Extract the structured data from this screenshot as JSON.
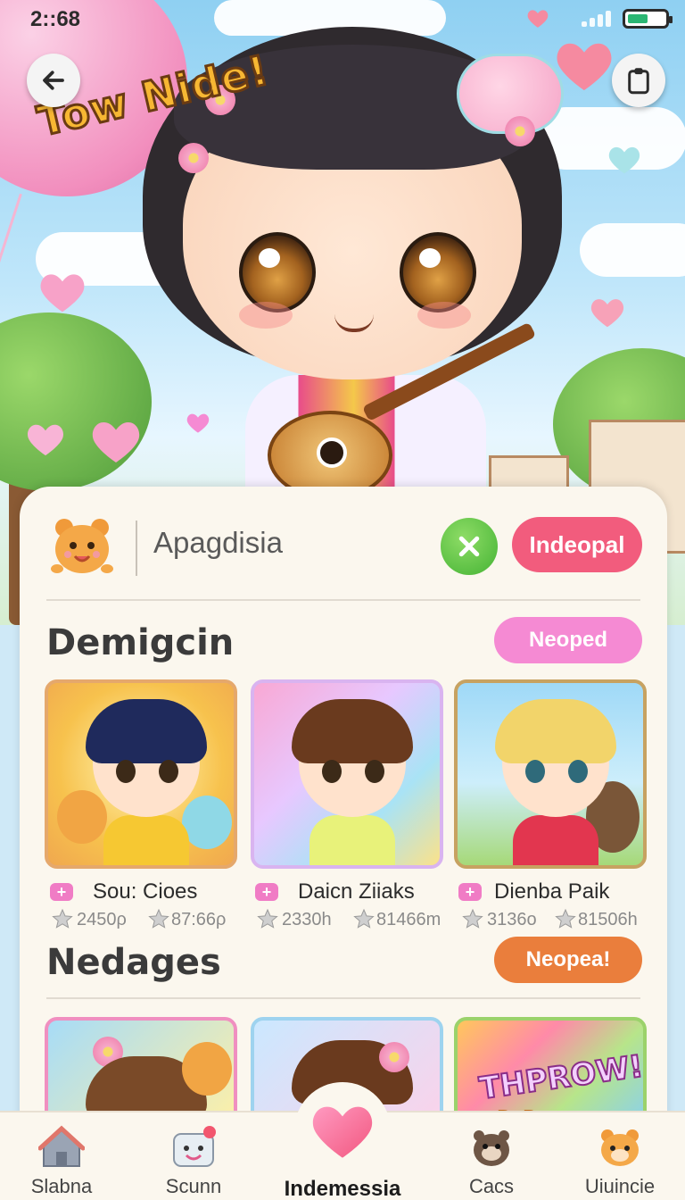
{
  "status_bar": {
    "time": "2::68"
  },
  "hero": {
    "title_art": "Tow Nide!"
  },
  "header_actions": {
    "back_icon": "back-arrow-icon",
    "share_icon": "clipboard-icon"
  },
  "search": {
    "text": "Apagdisia",
    "clear_icon": "close-icon",
    "action_label": "Indeopal"
  },
  "sections": [
    {
      "title": "Demigcin",
      "action_label": "Neoped",
      "cards": [
        {
          "name": "Sou: Cioes",
          "stat1": "2450ρ",
          "stat2": "87:66ρ"
        },
        {
          "name": "Daicn Ziiaks",
          "stat1": "2330h",
          "stat2": "81466m"
        },
        {
          "name": "Dienba Paik",
          "stat1": "3136o",
          "stat2": "81506h"
        }
      ]
    },
    {
      "title": "Nedages",
      "action_label": "Neopea!",
      "cards": [
        {
          "banner": ""
        },
        {
          "banner": ""
        },
        {
          "banner": "THPROW!",
          "banner_sub": "BoBau"
        }
      ]
    }
  ],
  "nav": [
    {
      "label": "Slabna",
      "icon": "home-icon"
    },
    {
      "label": "Scunn",
      "icon": "camera-icon"
    },
    {
      "label": "Indemessia",
      "icon": "heart-icon"
    },
    {
      "label": "Cacs",
      "icon": "otter-icon"
    },
    {
      "label": "Uiuincie",
      "icon": "hamster-icon"
    }
  ],
  "colors": {
    "accent_red": "#f25c7d",
    "accent_pink": "#f58ad3",
    "accent_orange": "#ea7e3c",
    "confirm_green": "#44b334"
  }
}
